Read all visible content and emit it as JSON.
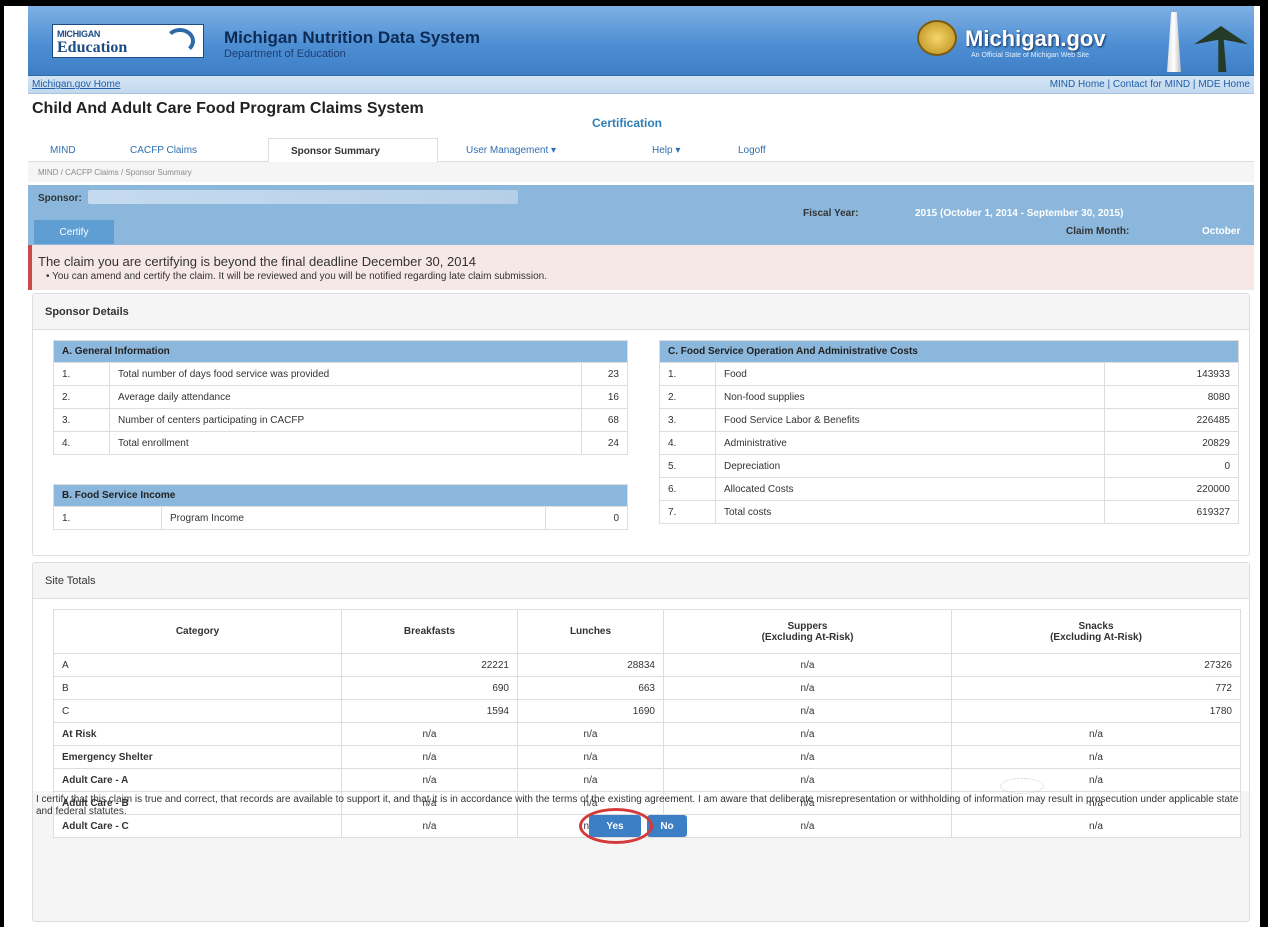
{
  "banner": {
    "logo_line1": "MICHIGAN",
    "logo_line2": "Education",
    "title": "Michigan Nutrition Data System",
    "subtitle": "Department of Education",
    "mi_logo_text": "Michigan.gov",
    "mi_logo_tagline": "An Official State of Michigan Web Site"
  },
  "linkbar": {
    "home_link": "Michigan.gov Home",
    "mind_home": "MIND Home",
    "contact": "Contact for MIND",
    "mde_home": "MDE Home",
    "separator": "|"
  },
  "app": {
    "title": "Child And Adult Care Food Program Claims System",
    "subtitle": "Certification"
  },
  "tabs": [
    {
      "label": "MIND"
    },
    {
      "label": "CACFP Claims"
    },
    {
      "label": "Sponsor Summary"
    },
    {
      "label": "User Management ▾"
    },
    {
      "label": "Help ▾"
    },
    {
      "label": "Logoff"
    }
  ],
  "breadcrumb": "MIND  /  CACFP Claims  /  Sponsor Summary",
  "sponsor": {
    "label": "Sponsor:",
    "certify_button": "Certify",
    "fiscal_year_label": "Fiscal Year:",
    "fiscal_year_value": "2015 (October 1, 2014 - September 30, 2015)",
    "claim_month_label": "Claim Month:",
    "claim_month_value": "October"
  },
  "alert": {
    "message": "The claim you are certifying is beyond the final deadline December 30, 2014",
    "detail": "•  You can amend and certify the claim. It will be reviewed and you will be notified regarding late claim submission."
  },
  "sponsor_details": {
    "heading": "Sponsor Details",
    "general": {
      "heading": "A. General Information",
      "rows": [
        {
          "num": "1.",
          "label": "Total number of days food service was provided",
          "value": "23"
        },
        {
          "num": "2.",
          "label": "Average daily attendance",
          "value": "16"
        },
        {
          "num": "3.",
          "label": "Number of centers participating in CACFP",
          "value": "68"
        },
        {
          "num": "4.",
          "label": "Total enrollment",
          "value": "24"
        }
      ]
    },
    "income": {
      "heading": "B. Food Service Income",
      "rows": [
        {
          "num": "1.",
          "label": "Program Income",
          "value": "0"
        }
      ]
    },
    "costs": {
      "heading": "C. Food Service Operation And Administrative Costs",
      "rows": [
        {
          "num": "1.",
          "label": "Food",
          "value": "143933"
        },
        {
          "num": "2.",
          "label": "Non-food supplies",
          "value": "8080"
        },
        {
          "num": "3.",
          "label": "Food Service Labor & Benefits",
          "value": "226485"
        },
        {
          "num": "4.",
          "label": "Administrative",
          "value": "20829"
        },
        {
          "num": "5.",
          "label": "Depreciation",
          "value": "0"
        },
        {
          "num": "6.",
          "label": "Allocated Costs",
          "value": "220000"
        },
        {
          "num": "7.",
          "label": "Total costs",
          "value": "619327"
        }
      ]
    }
  },
  "site_totals": {
    "heading": "Site Totals",
    "columns": [
      "Category",
      "Breakfasts",
      "Lunches",
      "Suppers",
      "(Excluding At-Risk)",
      "Snacks",
      "(Excluding At-Risk)"
    ],
    "rows": [
      {
        "category": "A",
        "breakfasts": "22221",
        "lunches": "28834",
        "suppers": "n/a",
        "snacks": "27326"
      },
      {
        "category": "B",
        "breakfasts": "690",
        "lunches": "663",
        "suppers": "n/a",
        "snacks": "772"
      },
      {
        "category": "C",
        "breakfasts": "1594",
        "lunches": "1690",
        "suppers": "n/a",
        "snacks": "1780"
      },
      {
        "category": "At Risk",
        "breakfasts": "n/a",
        "lunches": "n/a",
        "suppers": "n/a",
        "snacks": "n/a"
      },
      {
        "category": "Emergency Shelter",
        "breakfasts": "n/a",
        "lunches": "n/a",
        "suppers": "n/a",
        "snacks": "n/a"
      },
      {
        "category": "Adult Care - A",
        "breakfasts": "n/a",
        "lunches": "n/a",
        "suppers": "n/a",
        "snacks": "n/a"
      },
      {
        "category": "Adult Care - B",
        "breakfasts": "n/a",
        "lunches": "n/a",
        "suppers": "n/a",
        "snacks": "n/a"
      },
      {
        "category": "Adult Care - C",
        "breakfasts": "n/a",
        "lunches": "n/a",
        "suppers": "n/a",
        "snacks": "n/a"
      }
    ]
  },
  "certification": {
    "statement": "I certify that this claim is true and correct, that records are available to support it, and that it is in accordance with the terms of the existing agreement. I am aware that deliberate misrepresentation or withholding of information may result in prosecution under applicable state and federal statutes.",
    "yes": "Yes",
    "no": "No"
  },
  "colors": {
    "banner_blue": "#4e8fd4",
    "section_blue": "#8bb7dc",
    "button_blue": "#3d7fc5",
    "alert_red": "#c94a4a",
    "highlight_ring": "#d43a3a"
  }
}
